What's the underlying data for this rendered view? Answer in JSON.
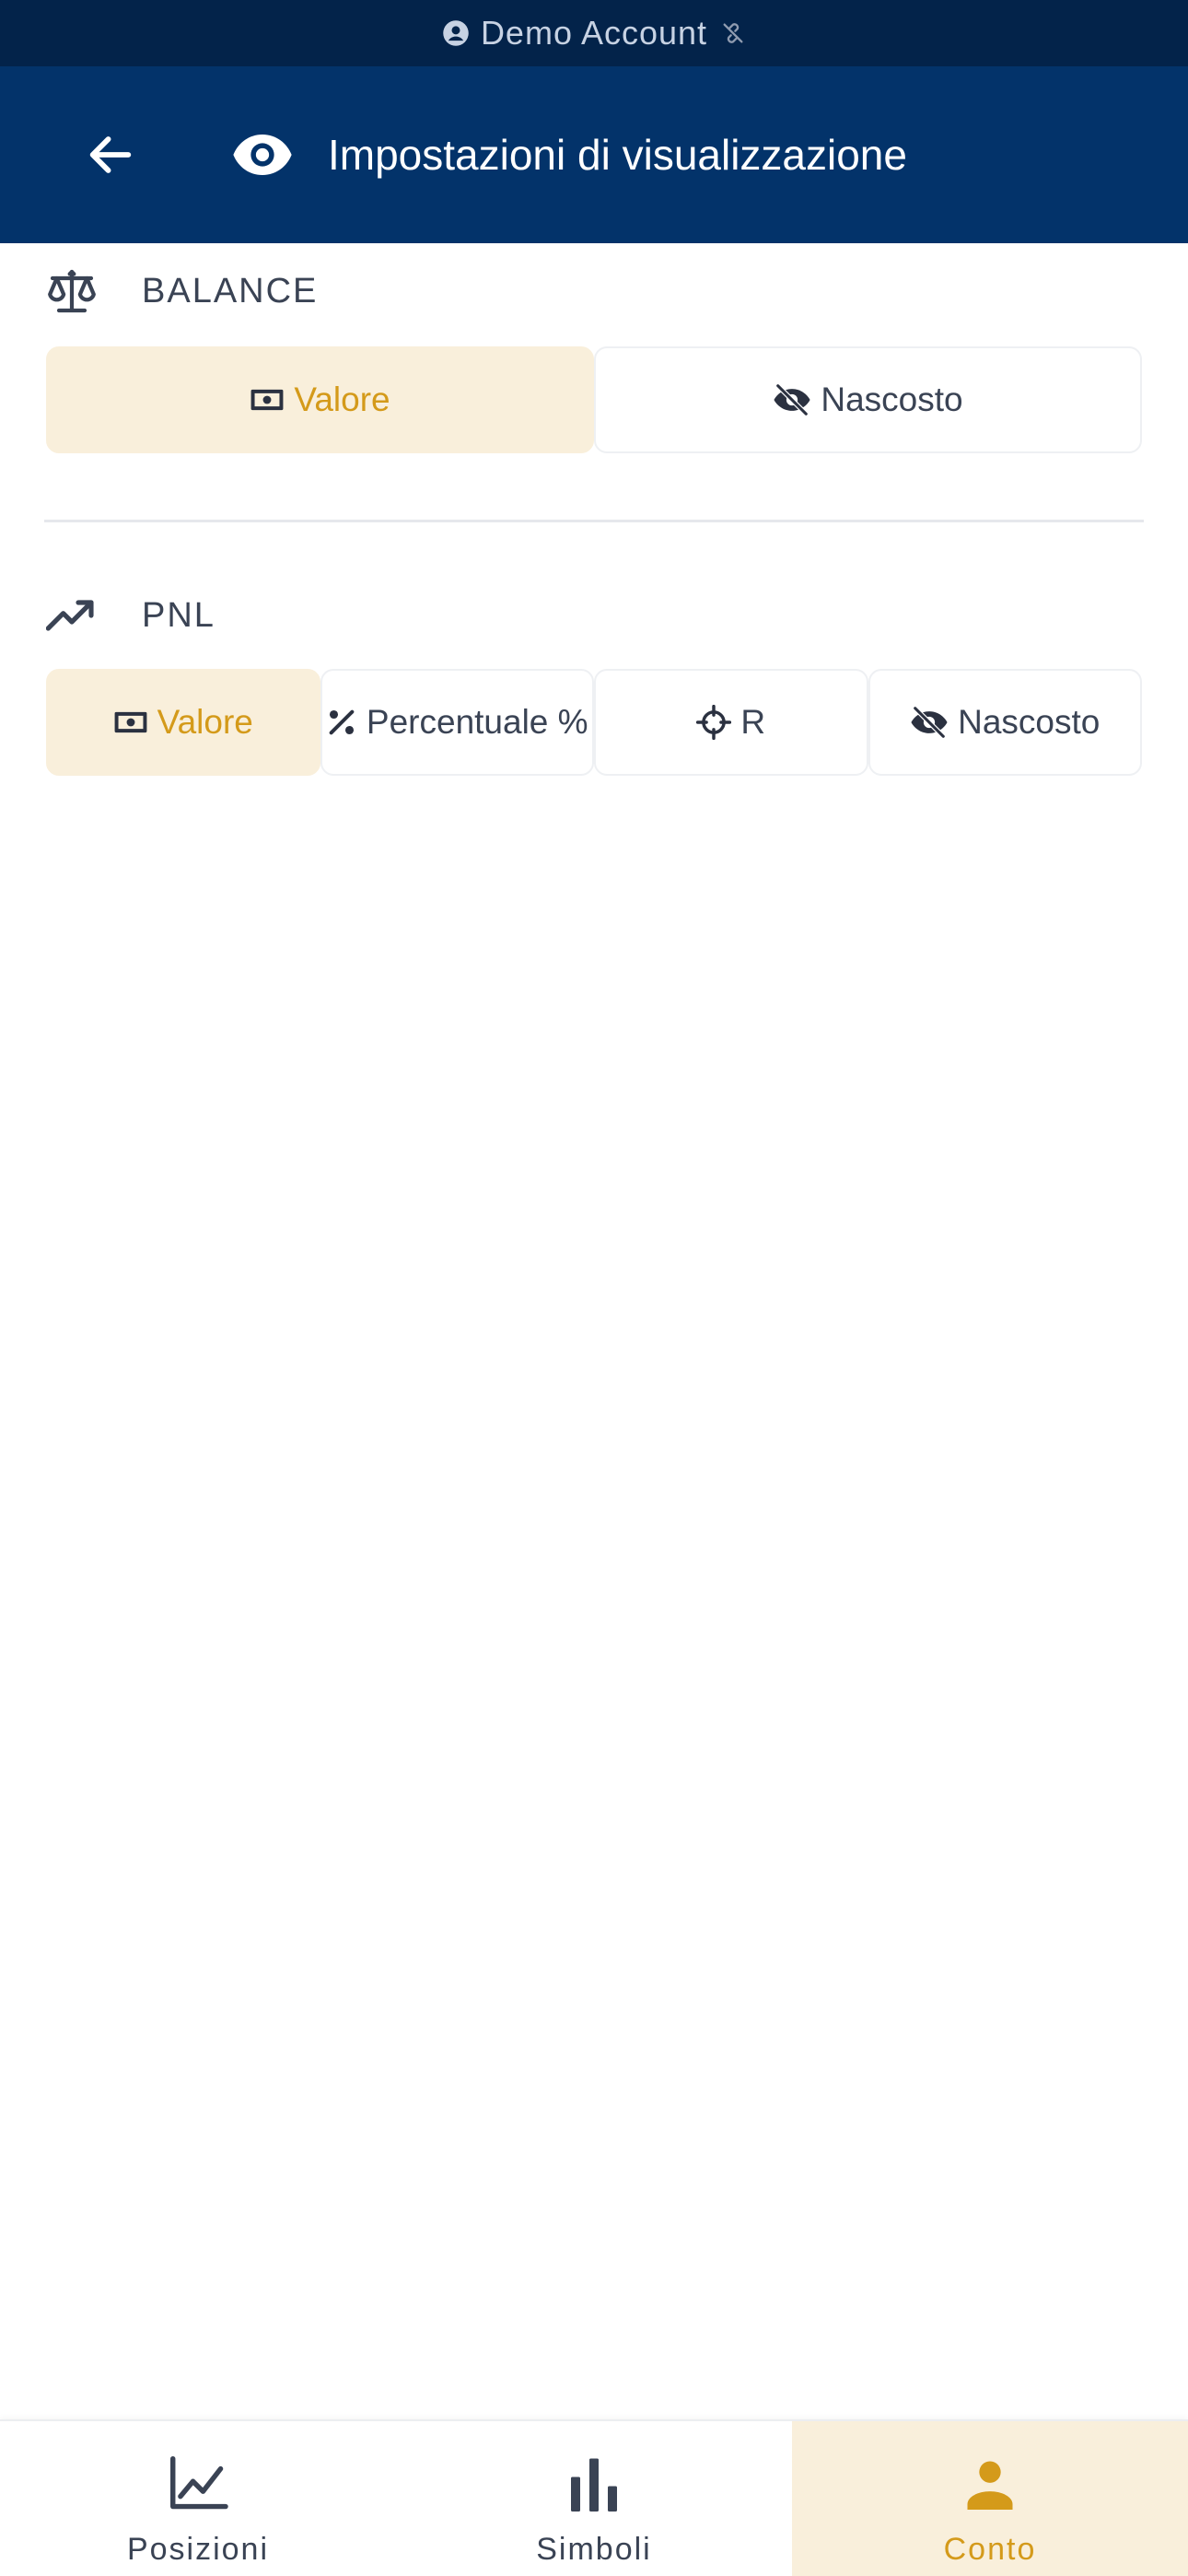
{
  "status_bar": {
    "account_label": "Demo Account",
    "icons": [
      "account-circle-icon",
      "link-off-icon"
    ]
  },
  "header": {
    "title": "Impostazioni di visualizzazione",
    "icons": [
      "arrow-left-icon",
      "eye-icon"
    ]
  },
  "balance": {
    "label": "BALANCE",
    "icon": "scale-icon",
    "options": [
      {
        "label": "Valore",
        "icon": "banknote-icon",
        "selected": true
      },
      {
        "label": "Nascosto",
        "icon": "eye-off-icon",
        "selected": false
      }
    ]
  },
  "pnl": {
    "label": "PNL",
    "icon": "trending-up-icon",
    "options": [
      {
        "label": "Valore",
        "icon": "banknote-icon",
        "selected": true
      },
      {
        "label": "Percentuale %",
        "icon": "percent-icon",
        "selected": false
      },
      {
        "label": "R",
        "icon": "crosshair-icon",
        "selected": false
      },
      {
        "label": "Nascosto",
        "icon": "eye-off-icon",
        "selected": false
      }
    ]
  },
  "bottom_nav": {
    "items": [
      {
        "label": "Posizioni",
        "icon": "line-chart-icon",
        "active": false
      },
      {
        "label": "Simboli",
        "icon": "bar-chart-icon",
        "active": false
      },
      {
        "label": "Conto",
        "icon": "person-icon",
        "active": true
      }
    ]
  },
  "colors": {
    "primary": "#03336a",
    "status_bar": "#03234a",
    "accent": "#d49a1a",
    "accent_bg": "#f9efdb",
    "text": "#3a4354"
  }
}
